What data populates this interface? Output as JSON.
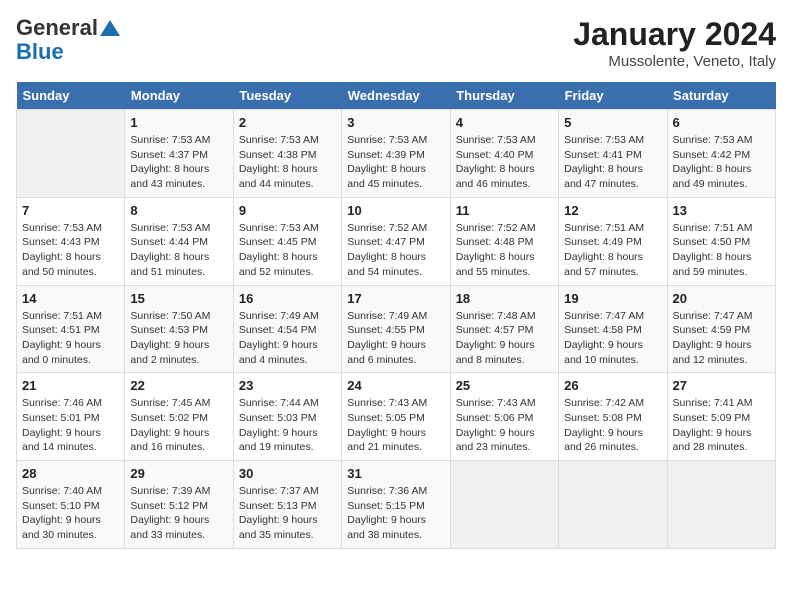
{
  "header": {
    "logo_general": "General",
    "logo_blue": "Blue",
    "title": "January 2024",
    "subtitle": "Mussolente, Veneto, Italy"
  },
  "days_of_week": [
    "Sunday",
    "Monday",
    "Tuesday",
    "Wednesday",
    "Thursday",
    "Friday",
    "Saturday"
  ],
  "weeks": [
    [
      {
        "day": "",
        "sunrise": "",
        "sunset": "",
        "daylight": "",
        "empty": true
      },
      {
        "day": "1",
        "sunrise": "Sunrise: 7:53 AM",
        "sunset": "Sunset: 4:37 PM",
        "daylight": "Daylight: 8 hours and 43 minutes."
      },
      {
        "day": "2",
        "sunrise": "Sunrise: 7:53 AM",
        "sunset": "Sunset: 4:38 PM",
        "daylight": "Daylight: 8 hours and 44 minutes."
      },
      {
        "day": "3",
        "sunrise": "Sunrise: 7:53 AM",
        "sunset": "Sunset: 4:39 PM",
        "daylight": "Daylight: 8 hours and 45 minutes."
      },
      {
        "day": "4",
        "sunrise": "Sunrise: 7:53 AM",
        "sunset": "Sunset: 4:40 PM",
        "daylight": "Daylight: 8 hours and 46 minutes."
      },
      {
        "day": "5",
        "sunrise": "Sunrise: 7:53 AM",
        "sunset": "Sunset: 4:41 PM",
        "daylight": "Daylight: 8 hours and 47 minutes."
      },
      {
        "day": "6",
        "sunrise": "Sunrise: 7:53 AM",
        "sunset": "Sunset: 4:42 PM",
        "daylight": "Daylight: 8 hours and 49 minutes."
      }
    ],
    [
      {
        "day": "7",
        "sunrise": "Sunrise: 7:53 AM",
        "sunset": "Sunset: 4:43 PM",
        "daylight": "Daylight: 8 hours and 50 minutes."
      },
      {
        "day": "8",
        "sunrise": "Sunrise: 7:53 AM",
        "sunset": "Sunset: 4:44 PM",
        "daylight": "Daylight: 8 hours and 51 minutes."
      },
      {
        "day": "9",
        "sunrise": "Sunrise: 7:53 AM",
        "sunset": "Sunset: 4:45 PM",
        "daylight": "Daylight: 8 hours and 52 minutes."
      },
      {
        "day": "10",
        "sunrise": "Sunrise: 7:52 AM",
        "sunset": "Sunset: 4:47 PM",
        "daylight": "Daylight: 8 hours and 54 minutes."
      },
      {
        "day": "11",
        "sunrise": "Sunrise: 7:52 AM",
        "sunset": "Sunset: 4:48 PM",
        "daylight": "Daylight: 8 hours and 55 minutes."
      },
      {
        "day": "12",
        "sunrise": "Sunrise: 7:51 AM",
        "sunset": "Sunset: 4:49 PM",
        "daylight": "Daylight: 8 hours and 57 minutes."
      },
      {
        "day": "13",
        "sunrise": "Sunrise: 7:51 AM",
        "sunset": "Sunset: 4:50 PM",
        "daylight": "Daylight: 8 hours and 59 minutes."
      }
    ],
    [
      {
        "day": "14",
        "sunrise": "Sunrise: 7:51 AM",
        "sunset": "Sunset: 4:51 PM",
        "daylight": "Daylight: 9 hours and 0 minutes."
      },
      {
        "day": "15",
        "sunrise": "Sunrise: 7:50 AM",
        "sunset": "Sunset: 4:53 PM",
        "daylight": "Daylight: 9 hours and 2 minutes."
      },
      {
        "day": "16",
        "sunrise": "Sunrise: 7:49 AM",
        "sunset": "Sunset: 4:54 PM",
        "daylight": "Daylight: 9 hours and 4 minutes."
      },
      {
        "day": "17",
        "sunrise": "Sunrise: 7:49 AM",
        "sunset": "Sunset: 4:55 PM",
        "daylight": "Daylight: 9 hours and 6 minutes."
      },
      {
        "day": "18",
        "sunrise": "Sunrise: 7:48 AM",
        "sunset": "Sunset: 4:57 PM",
        "daylight": "Daylight: 9 hours and 8 minutes."
      },
      {
        "day": "19",
        "sunrise": "Sunrise: 7:47 AM",
        "sunset": "Sunset: 4:58 PM",
        "daylight": "Daylight: 9 hours and 10 minutes."
      },
      {
        "day": "20",
        "sunrise": "Sunrise: 7:47 AM",
        "sunset": "Sunset: 4:59 PM",
        "daylight": "Daylight: 9 hours and 12 minutes."
      }
    ],
    [
      {
        "day": "21",
        "sunrise": "Sunrise: 7:46 AM",
        "sunset": "Sunset: 5:01 PM",
        "daylight": "Daylight: 9 hours and 14 minutes."
      },
      {
        "day": "22",
        "sunrise": "Sunrise: 7:45 AM",
        "sunset": "Sunset: 5:02 PM",
        "daylight": "Daylight: 9 hours and 16 minutes."
      },
      {
        "day": "23",
        "sunrise": "Sunrise: 7:44 AM",
        "sunset": "Sunset: 5:03 PM",
        "daylight": "Daylight: 9 hours and 19 minutes."
      },
      {
        "day": "24",
        "sunrise": "Sunrise: 7:43 AM",
        "sunset": "Sunset: 5:05 PM",
        "daylight": "Daylight: 9 hours and 21 minutes."
      },
      {
        "day": "25",
        "sunrise": "Sunrise: 7:43 AM",
        "sunset": "Sunset: 5:06 PM",
        "daylight": "Daylight: 9 hours and 23 minutes."
      },
      {
        "day": "26",
        "sunrise": "Sunrise: 7:42 AM",
        "sunset": "Sunset: 5:08 PM",
        "daylight": "Daylight: 9 hours and 26 minutes."
      },
      {
        "day": "27",
        "sunrise": "Sunrise: 7:41 AM",
        "sunset": "Sunset: 5:09 PM",
        "daylight": "Daylight: 9 hours and 28 minutes."
      }
    ],
    [
      {
        "day": "28",
        "sunrise": "Sunrise: 7:40 AM",
        "sunset": "Sunset: 5:10 PM",
        "daylight": "Daylight: 9 hours and 30 minutes."
      },
      {
        "day": "29",
        "sunrise": "Sunrise: 7:39 AM",
        "sunset": "Sunset: 5:12 PM",
        "daylight": "Daylight: 9 hours and 33 minutes."
      },
      {
        "day": "30",
        "sunrise": "Sunrise: 7:37 AM",
        "sunset": "Sunset: 5:13 PM",
        "daylight": "Daylight: 9 hours and 35 minutes."
      },
      {
        "day": "31",
        "sunrise": "Sunrise: 7:36 AM",
        "sunset": "Sunset: 5:15 PM",
        "daylight": "Daylight: 9 hours and 38 minutes."
      },
      {
        "day": "",
        "sunrise": "",
        "sunset": "",
        "daylight": "",
        "empty": true
      },
      {
        "day": "",
        "sunrise": "",
        "sunset": "",
        "daylight": "",
        "empty": true
      },
      {
        "day": "",
        "sunrise": "",
        "sunset": "",
        "daylight": "",
        "empty": true
      }
    ]
  ]
}
